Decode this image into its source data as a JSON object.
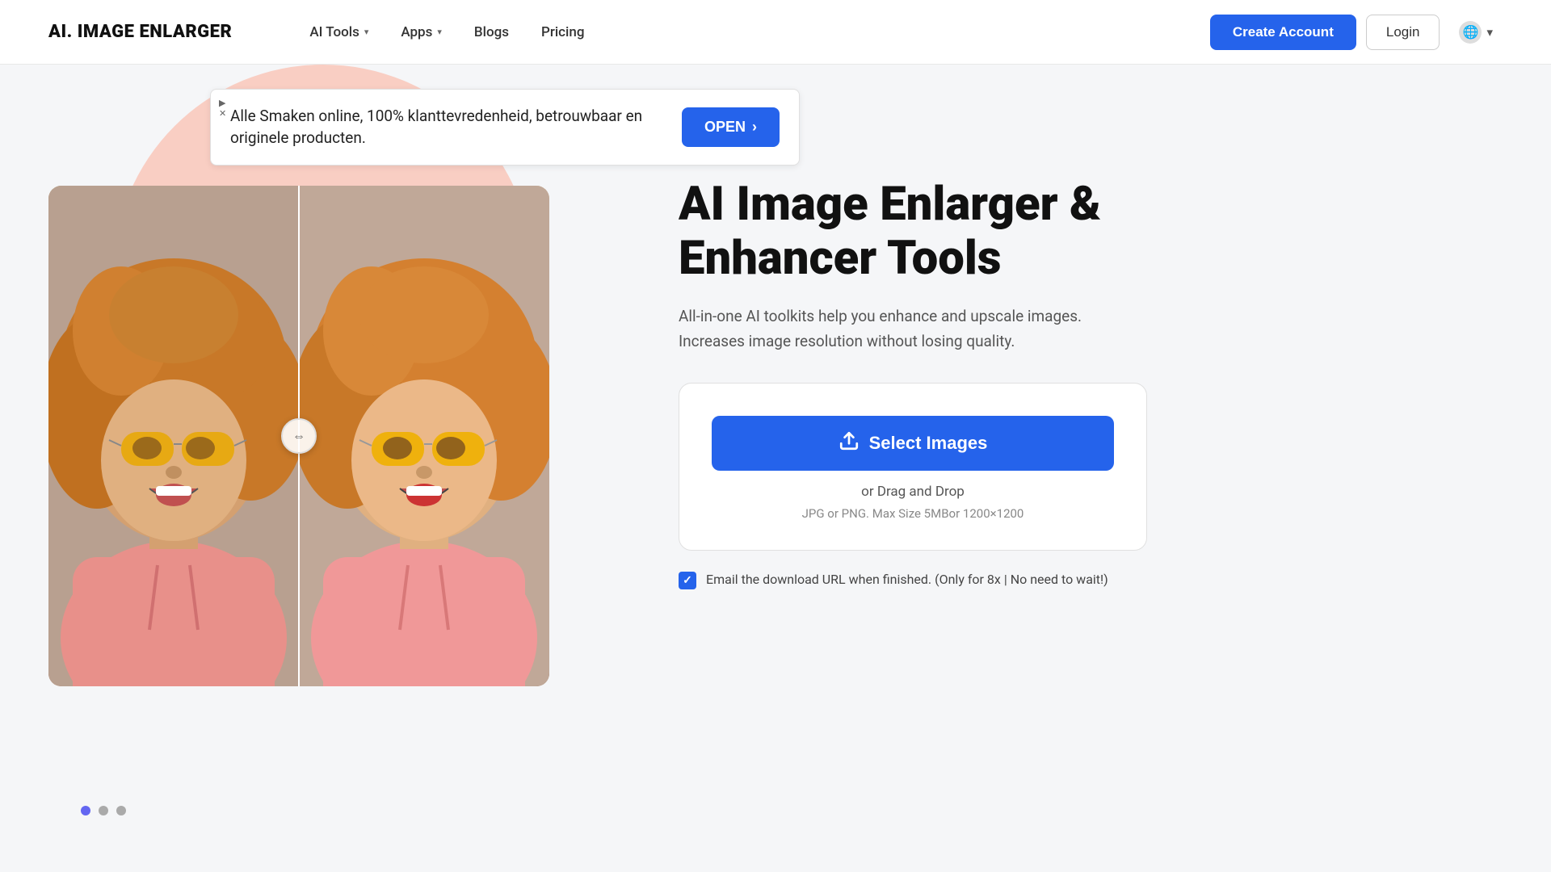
{
  "header": {
    "logo": "AI. IMAGE ENLARGER",
    "nav": [
      {
        "label": "AI Tools",
        "has_dropdown": true
      },
      {
        "label": "Apps",
        "has_dropdown": true
      },
      {
        "label": "Blogs",
        "has_dropdown": false
      },
      {
        "label": "Pricing",
        "has_dropdown": false
      }
    ],
    "create_account": "Create Account",
    "login": "Login",
    "lang_icon": "🌐",
    "lang_dropdown": "▾"
  },
  "ad": {
    "text": "Alle Smaken online, 100% klanttevredenheid,\nbetrouwbaar en originele producten.",
    "open_btn": "OPEN",
    "open_arrow": "›"
  },
  "hero": {
    "title": "AI Image Enlarger &\nEnhancer Tools",
    "subtitle": "All-in-one AI toolkits help you enhance and upscale images.\nIncreases image resolution without losing quality.",
    "upload_box": {
      "select_btn": "Select Images",
      "drag_drop": "or Drag and Drop",
      "file_info": "JPG or PNG. Max Size 5MBor 1200×1200"
    },
    "email_label": "Email the download URL when finished. (Only for 8x | No need to wait!)"
  },
  "dots": [
    {
      "active": true
    },
    {
      "active": false
    },
    {
      "active": false
    }
  ],
  "colors": {
    "blue": "#2563eb",
    "pink_blob": "#f9cec3",
    "text_dark": "#111",
    "text_mid": "#555",
    "text_light": "#888"
  }
}
